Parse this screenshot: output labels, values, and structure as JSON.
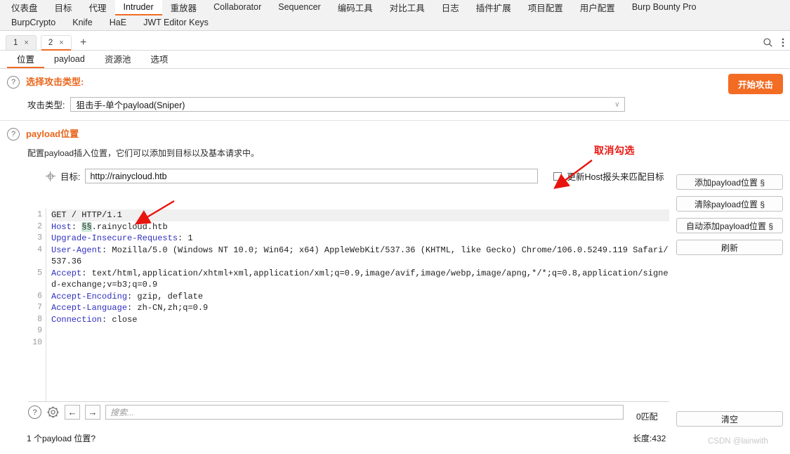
{
  "window": {
    "title": "Burp Suite Intruder"
  },
  "main_tabs_row1": [
    {
      "label": "仪表盘",
      "active": false
    },
    {
      "label": "目标",
      "active": false
    },
    {
      "label": "代理",
      "active": false
    },
    {
      "label": "Intruder",
      "active": true
    },
    {
      "label": "重放器",
      "active": false
    },
    {
      "label": "Collaborator",
      "active": false
    },
    {
      "label": "Sequencer",
      "active": false
    },
    {
      "label": "编码工具",
      "active": false
    },
    {
      "label": "对比工具",
      "active": false
    },
    {
      "label": "日志",
      "active": false
    },
    {
      "label": "插件扩展",
      "active": false
    },
    {
      "label": "项目配置",
      "active": false
    },
    {
      "label": "用户配置",
      "active": false
    },
    {
      "label": "Burp Bounty Pro",
      "active": false
    }
  ],
  "main_tabs_row2": [
    {
      "label": "BurpCrypto",
      "active": false
    },
    {
      "label": "Knife",
      "active": false
    },
    {
      "label": "HaE",
      "active": false
    },
    {
      "label": "JWT Editor Keys",
      "active": false
    }
  ],
  "attack_tabs": [
    {
      "label": "1",
      "close": "×",
      "active": false
    },
    {
      "label": "2",
      "close": "×",
      "active": true
    }
  ],
  "attack_tab_add": "+",
  "tabstrip_icons": {
    "search": "search-icon",
    "menu": "kebab-menu-icon"
  },
  "sub_tabs": [
    {
      "label": "位置",
      "active": true
    },
    {
      "label": "payload",
      "active": false
    },
    {
      "label": "资源池",
      "active": false
    },
    {
      "label": "选项",
      "active": false
    }
  ],
  "attack_type_section": {
    "help_icon": "?",
    "title": "选择攻击类型:",
    "start_button": "开始攻击",
    "field_label": "攻击类型:",
    "selected_value": "狙击手-单个payload(Sniper)",
    "chevron": "∨"
  },
  "payload_positions_section": {
    "help_icon": "?",
    "title": "payload位置",
    "description": "配置payload插入位置，它们可以添加到目标以及基本请求中。",
    "target_label": "目标:",
    "target_value": "http://rainycloud.htb",
    "update_host_checkbox_label": "更新Host报头来匹配目标",
    "update_host_checked": false
  },
  "annotation": {
    "text": "取消勾选",
    "color": "#e8150f"
  },
  "request_editor": {
    "line_numbers": [
      "1",
      "2",
      "3",
      "4",
      "5",
      "6",
      "7",
      "8",
      "9",
      "10"
    ],
    "lines": [
      {
        "n": "1",
        "highlight": true,
        "text": "GET / HTTP/1.1"
      },
      {
        "n": "2",
        "highlight": false,
        "text": "Host: §§.rainycloud.htb"
      },
      {
        "n": "3",
        "highlight": false,
        "text": "Upgrade-Insecure-Requests: 1"
      },
      {
        "n": "4",
        "highlight": false,
        "text": "User-Agent: Mozilla/5.0 (Windows NT 10.0; Win64; x64) AppleWebKit/537.36 (KHTML, like Gecko) Chrome/106.0.5249.119 Safari/537.36"
      },
      {
        "n": "5",
        "highlight": false,
        "text": "Accept: text/html,application/xhtml+xml,application/xml;q=0.9,image/avif,image/webp,image/apng,*/*;q=0.8,application/signed-exchange;v=b3;q=0.9"
      },
      {
        "n": "6",
        "highlight": false,
        "text": "Accept-Encoding: gzip, deflate"
      },
      {
        "n": "7",
        "highlight": false,
        "text": "Accept-Language: zh-CN,zh;q=0.9"
      },
      {
        "n": "8",
        "highlight": false,
        "text": "Connection: close"
      },
      {
        "n": "9",
        "highlight": false,
        "text": ""
      },
      {
        "n": "10",
        "highlight": false,
        "text": ""
      }
    ],
    "payload_marker": "§"
  },
  "side_buttons": [
    {
      "label": "添加payload位置 §"
    },
    {
      "label": "清除payload位置 §"
    },
    {
      "label": "自动添加payload位置 §"
    },
    {
      "label": "刷新"
    }
  ],
  "bottom_toolbar": {
    "help_icon": "?",
    "gear_icon": "gear-icon",
    "prev_arrow": "←",
    "next_arrow": "→",
    "search_placeholder": "搜索...",
    "search_value": "",
    "match_count": "0匹配",
    "clear_button": "清空"
  },
  "status_bar": {
    "left": "1 个payload 位置?",
    "right": "长度:432"
  },
  "watermark": "CSDN @lainwith",
  "colors": {
    "accent": "#f26c24",
    "section_title": "#e8661b",
    "annotation": "#e8150f",
    "marker_highlight": "#cdebdb",
    "keyword": "#2f2fbf"
  }
}
